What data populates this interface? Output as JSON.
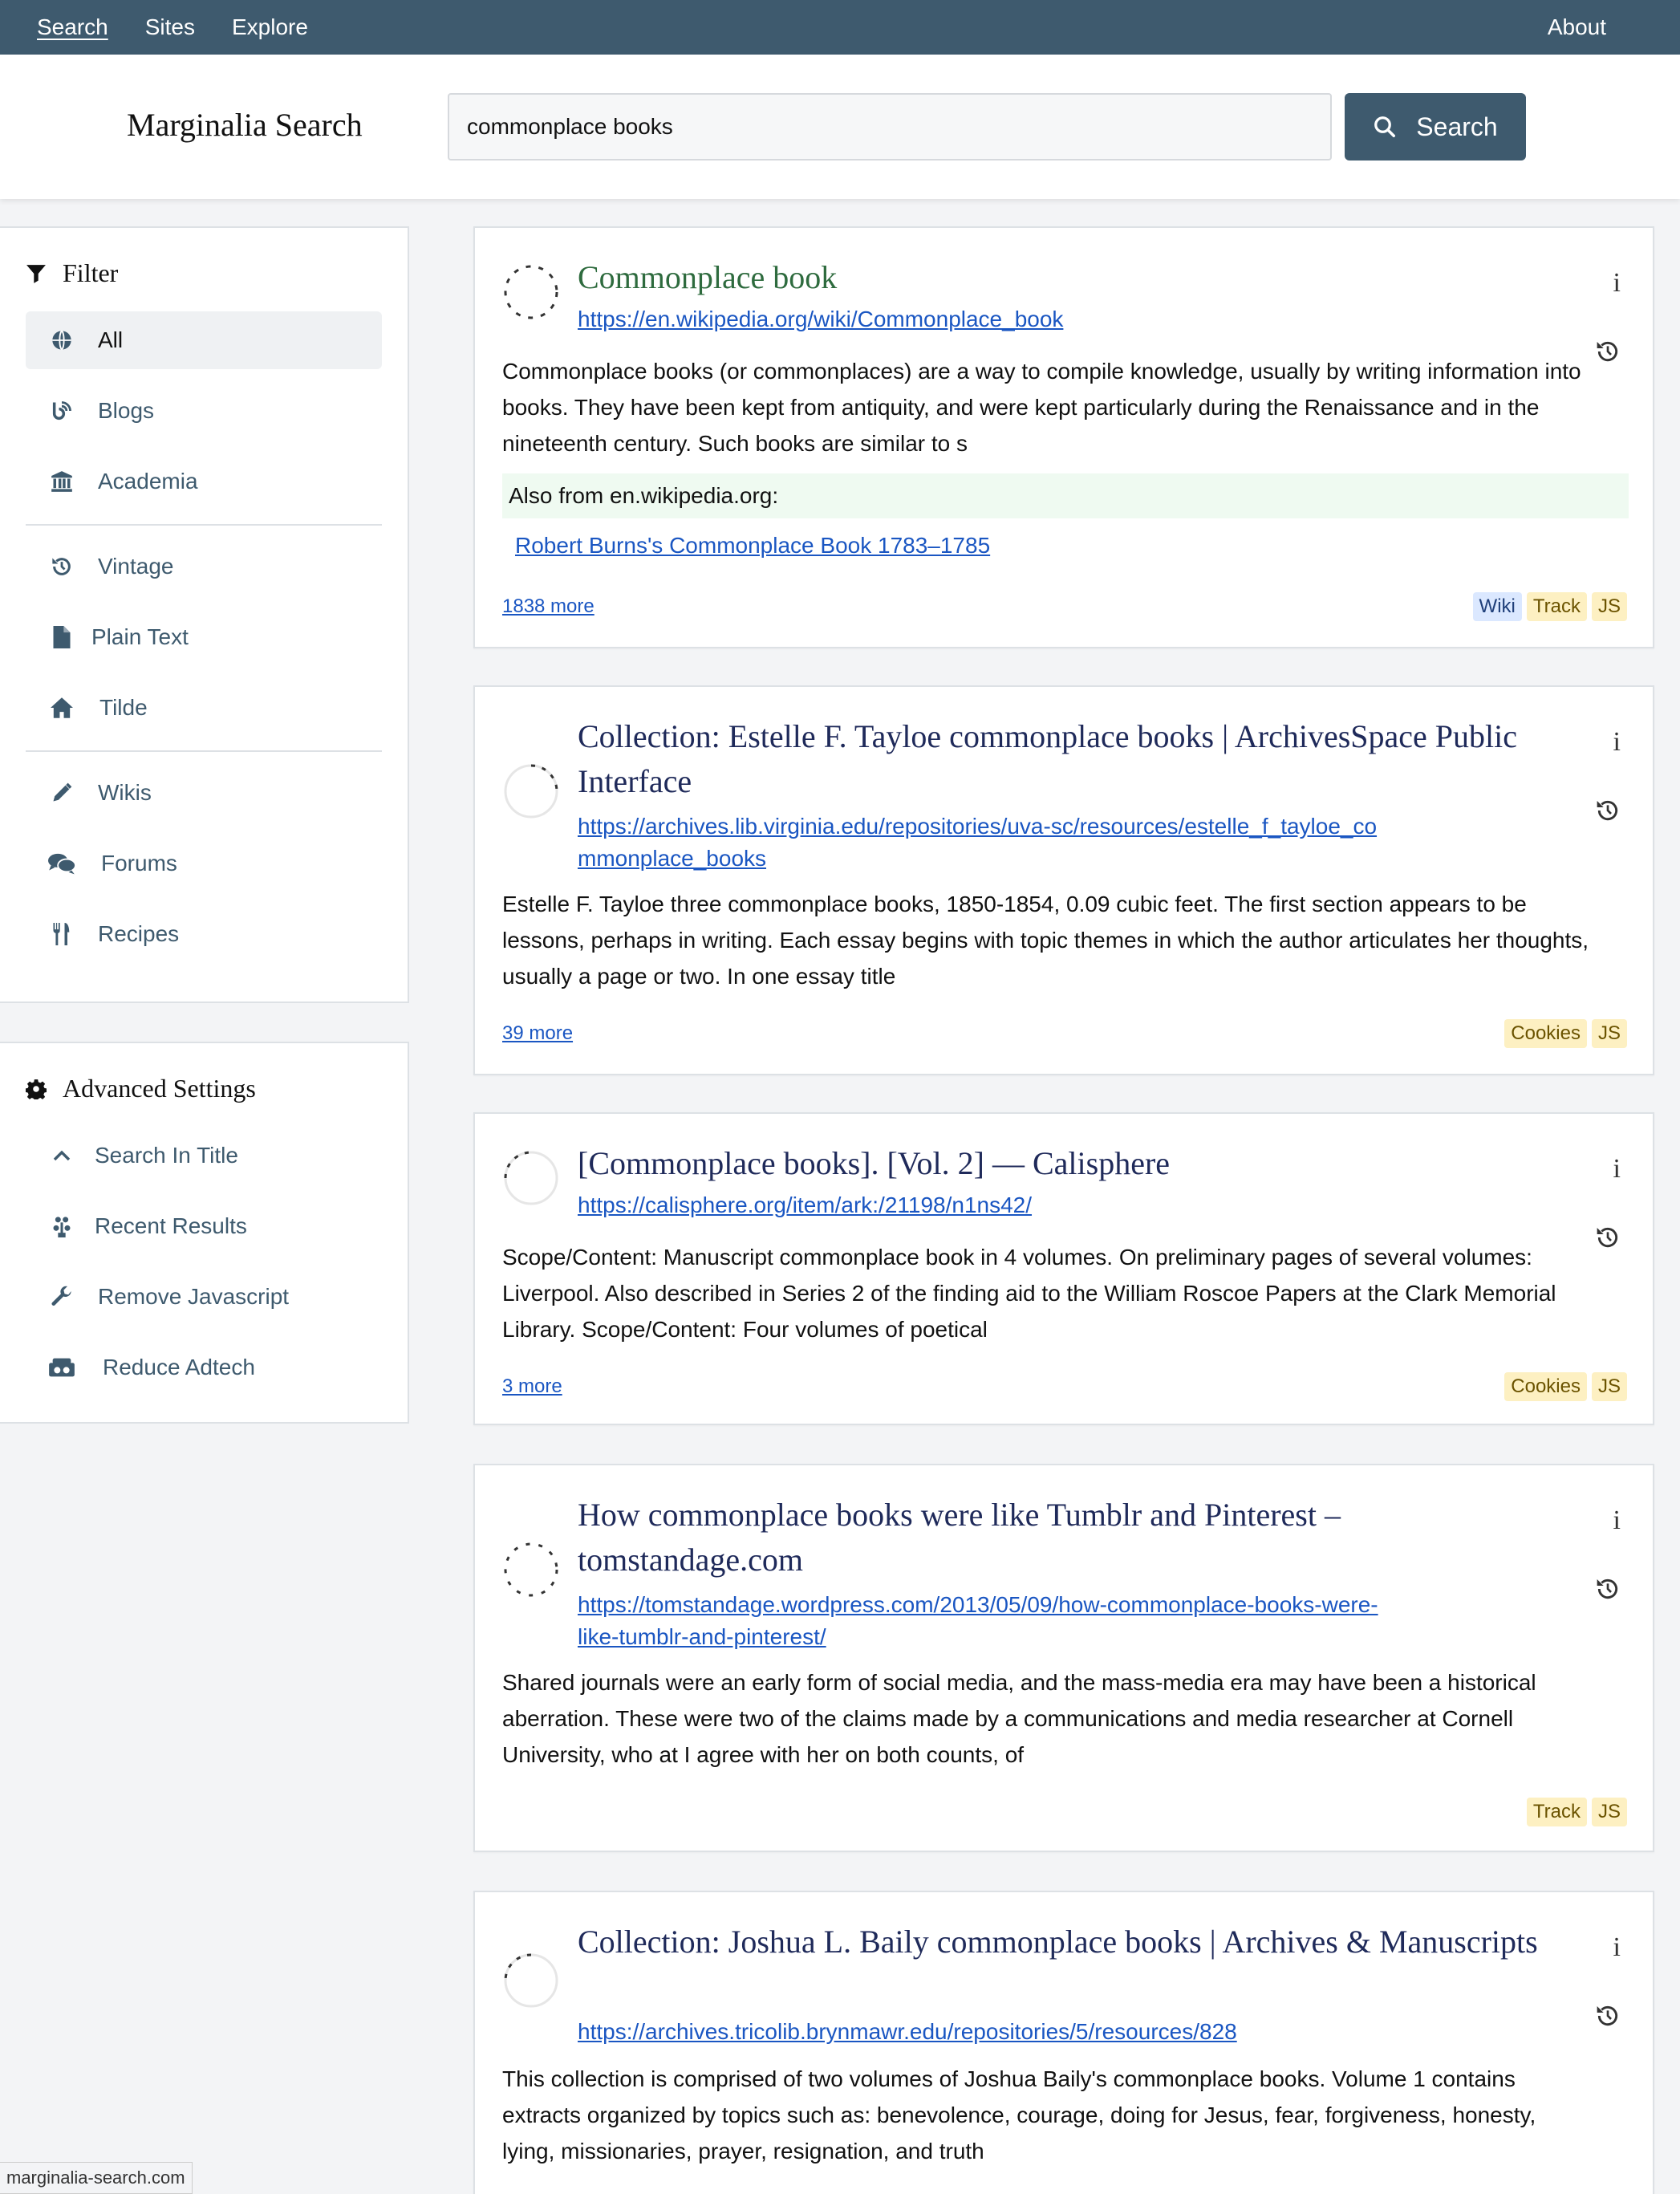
{
  "nav": {
    "items": [
      "Search",
      "Sites",
      "Explore"
    ],
    "about": "About"
  },
  "header": {
    "brand": "Marginalia Search",
    "query": "commonplace books",
    "search_button": "Search"
  },
  "filter": {
    "title": "Filter",
    "items": [
      {
        "label": "All",
        "icon": "globe-icon"
      },
      {
        "label": "Blogs",
        "icon": "blog-icon"
      },
      {
        "label": "Academia",
        "icon": "university-icon"
      },
      {
        "label": "Vintage",
        "icon": "history-icon"
      },
      {
        "label": "Plain Text",
        "icon": "file-icon"
      },
      {
        "label": "Tilde",
        "icon": "home-icon"
      },
      {
        "label": "Wikis",
        "icon": "pencil-icon"
      },
      {
        "label": "Forums",
        "icon": "comments-icon"
      },
      {
        "label": "Recipes",
        "icon": "utensils-icon"
      }
    ]
  },
  "advanced": {
    "title": "Advanced Settings",
    "items": [
      {
        "label": "Search In Title",
        "icon": "chevron-up-icon"
      },
      {
        "label": "Recent Results",
        "icon": "seedling-icon"
      },
      {
        "label": "Remove Javascript",
        "icon": "wrench-icon"
      },
      {
        "label": "Reduce Adtech",
        "icon": "ad-block-icon"
      }
    ]
  },
  "results": [
    {
      "title": "Commonplace book",
      "url": "https://en.wikipedia.org/wiki/Commonplace_book",
      "description": "Commonplace books (or commonplaces) are a way to compile knowledge, usually by writing information into books. They have been kept from antiquity, and were kept particularly during the Renaissance and in the nineteenth century. Such books are similar to s",
      "also_from": "Also from en.wikipedia.org:",
      "also_link": "Robert Burns's Commonplace Book 1783–1785",
      "more": "1838 more",
      "badges": [
        "Wiki",
        "Track",
        "JS"
      ]
    },
    {
      "title": "Collection: Estelle F. Tayloe commonplace books | ArchivesSpace Public Interface",
      "url": "https://archives.lib.virginia.edu/repositories/uva-sc/resources/estelle_f_tayloe_commonplace_books",
      "description": "Estelle F. Tayloe three commonplace books, 1850-1854, 0.09 cubic feet. The first section appears to be lessons, perhaps in writing. Each essay begins with topic themes in which the author articulates her thoughts, usually a page or two. In one essay title",
      "more": "39 more",
      "badges": [
        "Cookies",
        "JS"
      ]
    },
    {
      "title": "[Commonplace books]. [Vol. 2] — Calisphere",
      "url": "https://calisphere.org/item/ark:/21198/n1ns42/",
      "description": "Scope/Content: Manuscript commonplace book in 4 volumes. On preliminary pages of several volumes: Liverpool. Also described in Series 2 of the finding aid to the William Roscoe Papers at the Clark Memorial Library. Scope/Content: Four volumes of poetical",
      "more": "3 more",
      "badges": [
        "Cookies",
        "JS"
      ]
    },
    {
      "title": "How commonplace books were like Tumblr and Pinterest – tomstandage.com",
      "url": "https://tomstandage.wordpress.com/2013/05/09/how-commonplace-books-were-like-tumblr-and-pinterest/",
      "description": "Shared journals were an early form of social media, and the mass-media era may have been a historical aberration. These were two of the claims made by a communications and media researcher at Cornell University, who at I agree with her on both counts, of",
      "more": "",
      "badges": [
        "Track",
        "JS"
      ]
    },
    {
      "title": "Collection: Joshua L. Baily commonplace books | Archives & Manuscripts",
      "url": "https://archives.tricolib.brynmawr.edu/repositories/5/resources/828",
      "description": "This collection is comprised of two volumes of Joshua Baily's commonplace books. Volume 1 contains extracts organized by topics such as: benevolence, courage, doing for Jesus, fear, forgiveness, honesty, lying, missionaries, prayer, resignation, and truth"
    }
  ],
  "info_glyph": "i",
  "status_bar": "marginalia-search.com"
}
